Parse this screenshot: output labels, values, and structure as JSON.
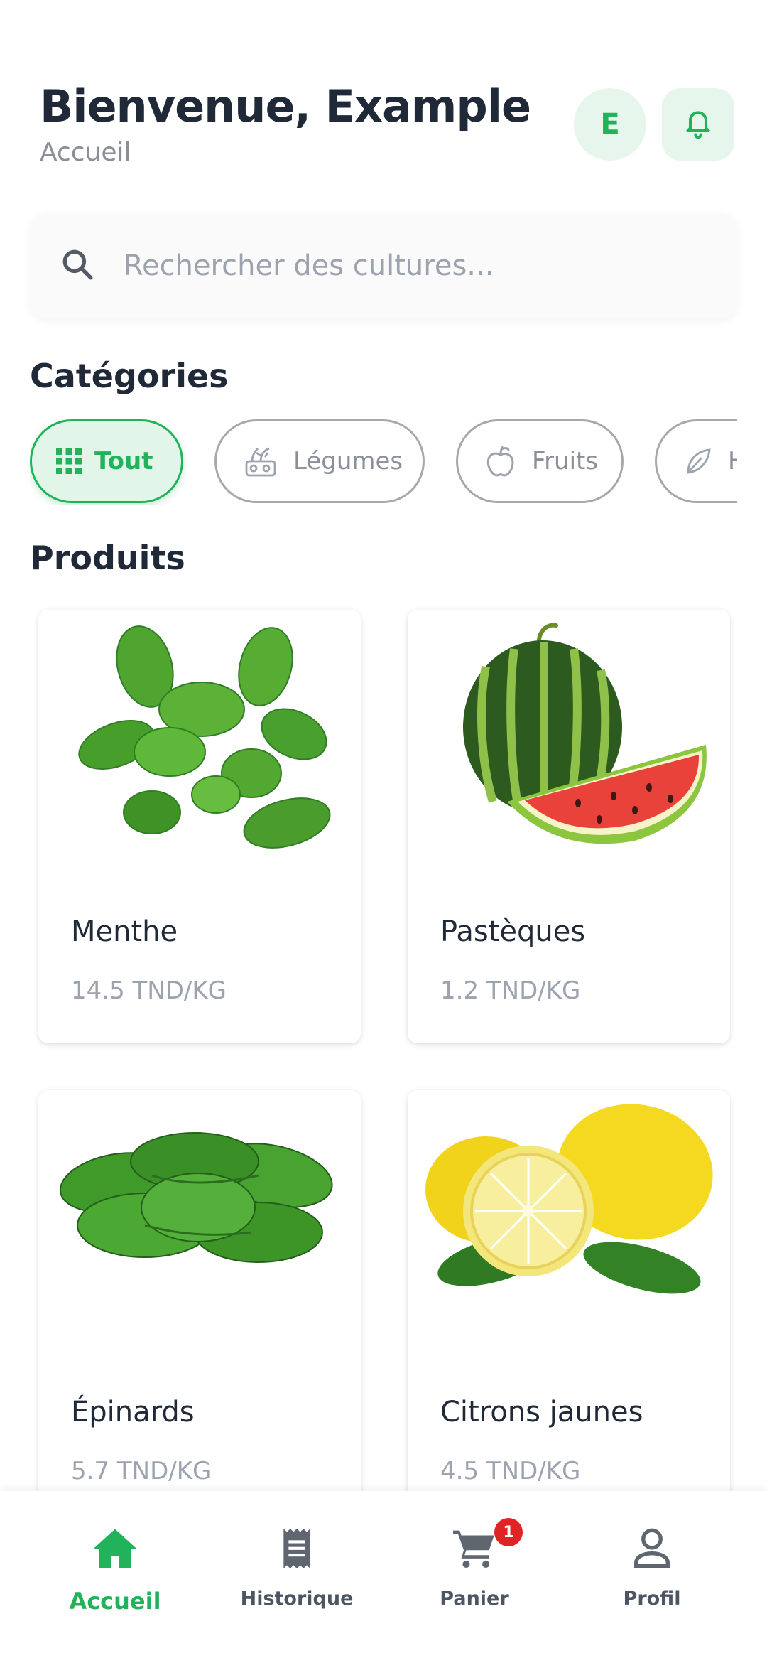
{
  "header": {
    "title": "Bienvenue, Example",
    "subtitle": "Accueil",
    "avatar_letter": "E"
  },
  "search": {
    "placeholder": "Rechercher des cultures..."
  },
  "categories": {
    "title": "Catégories",
    "items": [
      {
        "label": "Tout",
        "icon": "grid-icon",
        "active": true
      },
      {
        "label": "Légumes",
        "icon": "vegetables-icon",
        "active": false
      },
      {
        "label": "Fruits",
        "icon": "apple-icon",
        "active": false
      },
      {
        "label": "Herbes",
        "icon": "leaf-icon",
        "active": false
      }
    ]
  },
  "products": {
    "title": "Produits",
    "items": [
      {
        "name": "Menthe",
        "price": "14.5 TND/KG",
        "image": "mint-image"
      },
      {
        "name": "Pastèques",
        "price": "1.2 TND/KG",
        "image": "watermelon-image"
      },
      {
        "name": "Épinards",
        "price": "5.7 TND/KG",
        "image": "spinach-image"
      },
      {
        "name": "Citrons jaunes",
        "price": "4.5 TND/KG",
        "image": "lemon-image"
      }
    ]
  },
  "nav": {
    "items": [
      {
        "label": "Accueil",
        "icon": "home-icon",
        "active": true
      },
      {
        "label": "Historique",
        "icon": "receipt-icon",
        "active": false
      },
      {
        "label": "Panier",
        "icon": "cart-icon",
        "active": false,
        "badge": "1"
      },
      {
        "label": "Profil",
        "icon": "person-icon",
        "active": false
      }
    ]
  },
  "colors": {
    "accent": "#22b35a",
    "accent_light": "#e2f5e9",
    "text": "#1f2937",
    "muted": "#9ca3af",
    "badge": "#e02424"
  }
}
